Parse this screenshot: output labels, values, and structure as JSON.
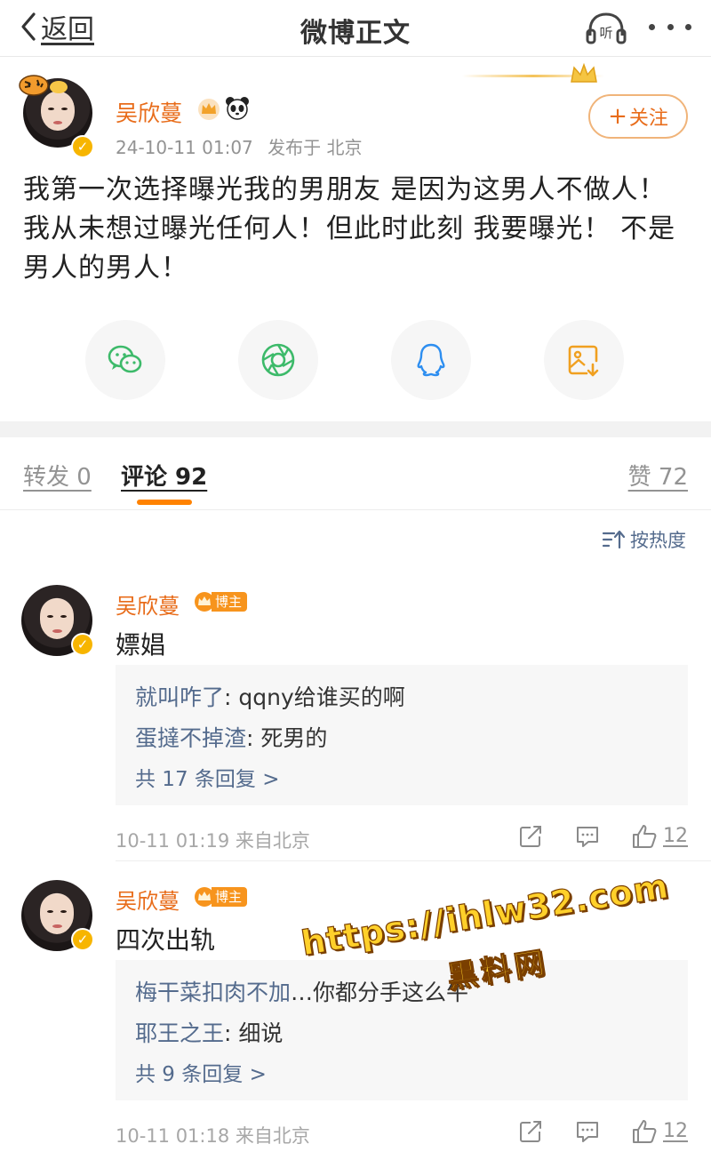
{
  "header": {
    "back_label": "返回",
    "title": "微博正文",
    "listen_icon_text": "听"
  },
  "post": {
    "author": "吴欣蔓",
    "timestamp": "24-10-11 01:07",
    "location": "发布于 北京",
    "follow_label": "关注",
    "text": "我第一次选择曝光我的男朋友 是因为这男人不做人！ 我从未想过曝光任何人！但此时此刻 我要曝光！ 不是男人的男人！",
    "share_icons": [
      "wechat-icon",
      "moments-icon",
      "qq-icon",
      "save-image-icon"
    ]
  },
  "tabs": {
    "repost": "转发 0",
    "comments": "评论 92",
    "likes": "赞 72"
  },
  "sort_label": "按热度",
  "comments": [
    {
      "name": "吴欣蔓",
      "badge": "博主",
      "text": "嫖娼",
      "replies": [
        {
          "name": "就叫咋了",
          "text": ": qqny给谁买的啊"
        },
        {
          "name": "蛋撻不掉渣",
          "text": ": 死男的"
        }
      ],
      "more": "共 17 条回复 >",
      "time": "10-11 01:19 来自北京",
      "likes": "12"
    },
    {
      "name": "吴欣蔓",
      "badge": "博主",
      "text": "四次出轨",
      "replies": [
        {
          "name": "梅干菜扣肉不加",
          "text": "…你都分手这么牛"
        },
        {
          "name": "耶王之王",
          "text": ": 细说"
        }
      ],
      "more": "共 9 条回复 >",
      "time": "10-11 01:18 来自北京",
      "likes": "12"
    }
  ],
  "watermark": {
    "url": "https://ihlw32.com",
    "name": "黑料网"
  },
  "colors": {
    "accent": "#e86c1a",
    "tab_indicator": "#ff8200",
    "link": "#546b8d",
    "verified": "#f7b500"
  }
}
